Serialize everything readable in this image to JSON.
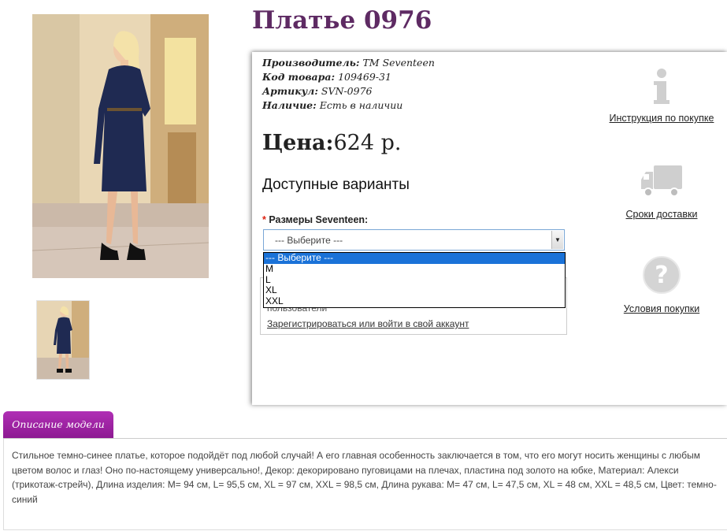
{
  "product": {
    "title": "Платье 0976",
    "manufacturer_label": "Производитель:",
    "manufacturer": "TM Seventeen",
    "code_label": "Код товара:",
    "code": "109469-31",
    "article_label": "Артикул:",
    "article": "SVN-0976",
    "availability_label": "Наличие:",
    "availability": "Есть в наличии"
  },
  "price": {
    "label": "Цена:",
    "value": "624 р."
  },
  "variants": {
    "heading": "Доступные варианты",
    "required_mark": "*",
    "size_label": "Размеры Seventeen:",
    "selected": "--- Выберите ---",
    "options": [
      "--- Выберите ---",
      "M",
      "L",
      "XL",
      "XXL"
    ]
  },
  "login_box": {
    "hint": "пользователи",
    "register_link": "Зарегистрироваться или войти в свой аккаунт"
  },
  "side_links": {
    "instructions": "Инструкция по покупке",
    "delivery": "Сроки доставки",
    "terms": "Условия покупки"
  },
  "description": {
    "tab_label": "Описание модели",
    "text": "Стильное темно-синее платье, которое подойдёт под любой случай! А его главная особенность заключается в том, что его могут носить женщины с любым цветом волос и глаз! Оно по-настоящему универсально!, Декор: декорировано пуговицами на плечах, пластина под золото на юбке, Материал: Алекси (трикотаж-стрейч), Длина изделия: M= 94 см, L= 95,5 см, XL = 97 см, XXL = 98,5 см, Длина рукава: M= 47 см, L= 47,5 см, XL = 48 см, XXL = 48,5 см, Цвет: темно-синий"
  },
  "colors": {
    "title": "#5e2a63",
    "tab": "#9b22a1",
    "select_highlight": "#1a72d8"
  },
  "icons": [
    "info-icon",
    "truck-icon",
    "question-icon"
  ]
}
